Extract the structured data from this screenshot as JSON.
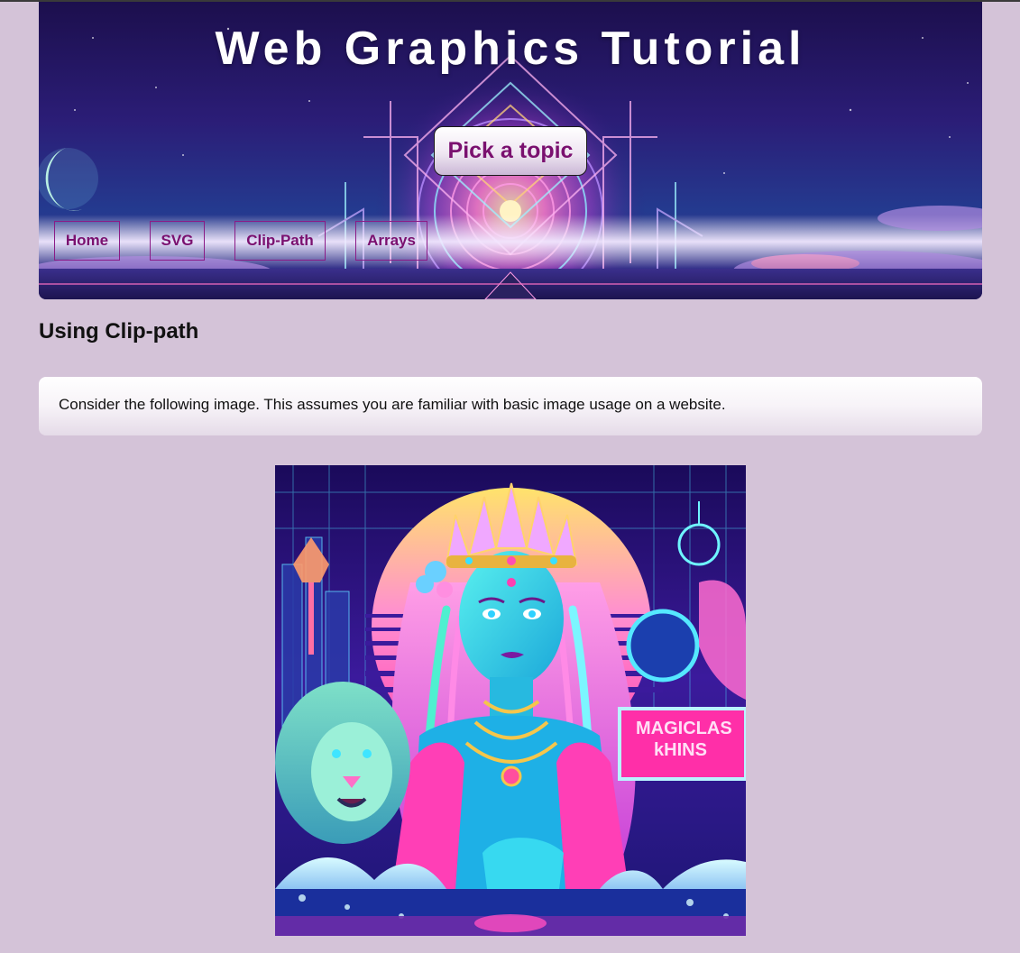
{
  "header": {
    "title": "Web Graphics Tutorial",
    "pick_topic_label": "Pick a topic",
    "nav": [
      {
        "label": "Home"
      },
      {
        "label": "SVG"
      },
      {
        "label": "Clip-Path"
      },
      {
        "label": "Arrays"
      }
    ]
  },
  "main": {
    "heading": "Using Clip-path",
    "intro_text": "Consider the following image. This assumes you are familiar with basic image usage on a website.",
    "artwork": {
      "sign_line1": "MAGICLAS",
      "sign_line2": "kHINS"
    }
  },
  "colors": {
    "page_background": "#d4c3d8",
    "nav_text": "#7a106f",
    "heading_text": "#111111"
  }
}
